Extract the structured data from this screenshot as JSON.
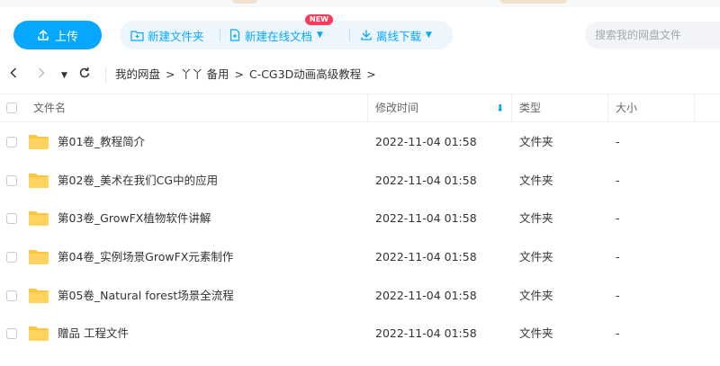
{
  "toolbar": {
    "upload_label": "上传",
    "new_folder_label": "新建文件夹",
    "new_online_doc_label": "新建在线文档",
    "new_badge": "NEW",
    "offline_download_label": "离线下载",
    "search_placeholder": "搜索我的网盘文件"
  },
  "breadcrumb": [
    "我的网盘",
    "丫丫 备用",
    "C-CG3D动画高级教程"
  ],
  "columns": {
    "name": "文件名",
    "modified": "修改时间",
    "type": "类型",
    "size": "大小"
  },
  "rows": [
    {
      "name": "第01卷_教程简介",
      "modified": "2022-11-04 01:58",
      "type": "文件夹",
      "size": "-"
    },
    {
      "name": "第02卷_美术在我们CG中的应用",
      "modified": "2022-11-04 01:58",
      "type": "文件夹",
      "size": "-"
    },
    {
      "name": "第03卷_GrowFX植物软件讲解",
      "modified": "2022-11-04 01:58",
      "type": "文件夹",
      "size": "-"
    },
    {
      "name": "第04卷_实例场景GrowFX元素制作",
      "modified": "2022-11-04 01:58",
      "type": "文件夹",
      "size": "-"
    },
    {
      "name": "第05卷_Natural forest场景全流程",
      "modified": "2022-11-04 01:58",
      "type": "文件夹",
      "size": "-"
    },
    {
      "name": "赠品 工程文件",
      "modified": "2022-11-04 01:58",
      "type": "文件夹",
      "size": "-"
    }
  ],
  "colors": {
    "accent": "#06a7ff",
    "pill_background": "#eef6fd",
    "badge": "#fa3b5b",
    "folder": "#ffc53d"
  },
  "icons": {
    "upload": "upload-icon",
    "new_folder": "folder-plus-icon",
    "new_doc": "document-plus-icon",
    "download": "download-icon",
    "back": "chevron-left-icon",
    "forward": "chevron-right-icon",
    "history": "caret-down-icon",
    "refresh": "refresh-icon",
    "folder": "folder-icon",
    "sort": "arrow-down-icon"
  }
}
